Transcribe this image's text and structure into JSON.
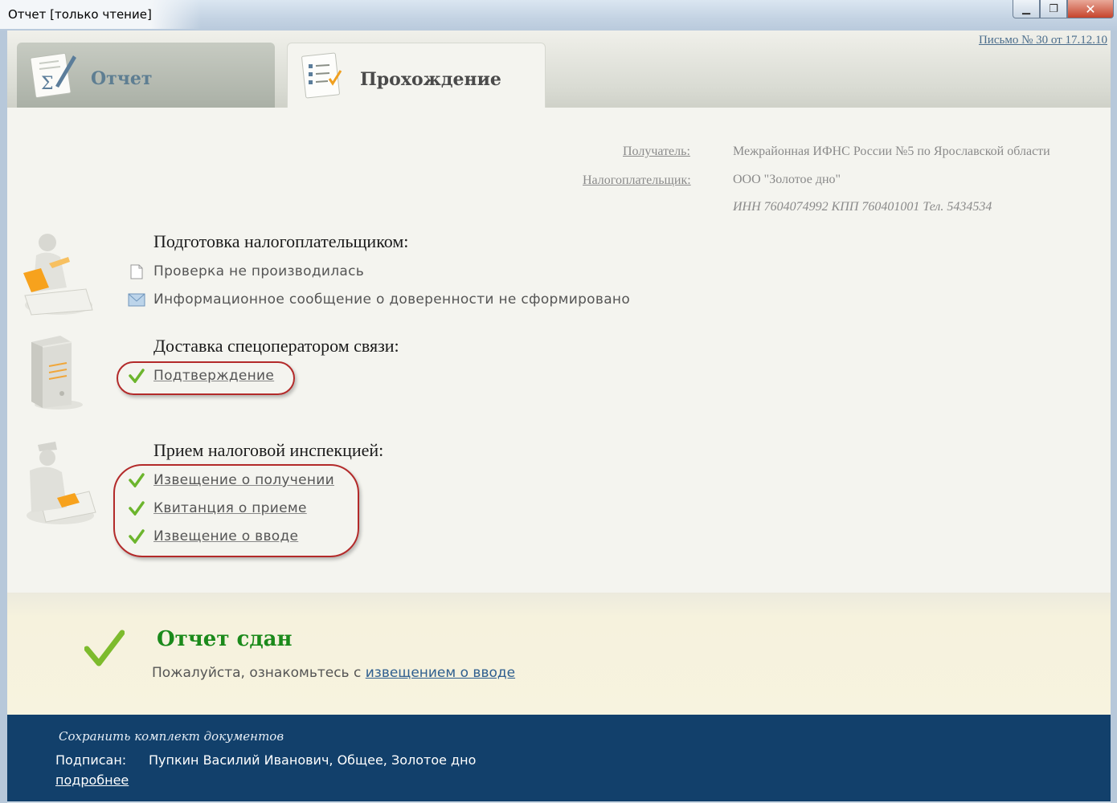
{
  "window": {
    "title": "Отчет [только чтение]",
    "minimize_glyph": "▁",
    "maximize_glyph": "❐",
    "close_glyph": "✕"
  },
  "tabs": [
    {
      "label": "Отчет",
      "icon": "report-sum-icon",
      "active": false
    },
    {
      "label": "Прохождение",
      "icon": "checklist-icon",
      "active": true
    }
  ],
  "header_link": "Письмо № 30 от 17.12.10",
  "info": {
    "recipient_label": "Получатель:",
    "recipient_value": "Межрайонная ИФНС России №5 по Ярославской области",
    "taxpayer_label": "Налогоплательщик:",
    "taxpayer_value": "ООО \"Золотое дно\"",
    "taxpayer_details": "ИНН 7604074992 КПП 760401001 Тел. 5434534"
  },
  "sections": [
    {
      "title": "Подготовка налогоплательщиком:",
      "figure": "taxpayer-figure-icon",
      "items": [
        {
          "text": "Проверка не производилась",
          "icon": "document-icon"
        },
        {
          "text": "Информационное сообщение о доверенности не сформировано",
          "icon": "envelope-icon"
        }
      ]
    },
    {
      "title": "Доставка спецоператором связи:",
      "figure": "server-icon",
      "items": [
        {
          "text": "Подтверждение",
          "icon": "checkmark-icon"
        }
      ]
    },
    {
      "title": "Прием налоговой инспекцией:",
      "figure": "inspector-figure-icon",
      "items": [
        {
          "text": "Извещение о получении",
          "icon": "checkmark-icon"
        },
        {
          "text": "Квитанция о приеме",
          "icon": "checkmark-icon"
        },
        {
          "text": "Извещение о вводе",
          "icon": "checkmark-icon"
        }
      ]
    }
  ],
  "status": {
    "title": "Отчет сдан",
    "message_prefix": "Пожалуйста, ознакомьтесь с ",
    "message_link": "извещением о вводе",
    "icon": "big-checkmark-icon",
    "color": "#1b8a1b"
  },
  "footer": {
    "save_link": "Сохранить комплект документов",
    "signed_label": "Подписан:",
    "signed_value": "Пупкин Василий Иванович, Общее, Золотое дно",
    "more_link": "подробнее",
    "background": "#12406b"
  }
}
